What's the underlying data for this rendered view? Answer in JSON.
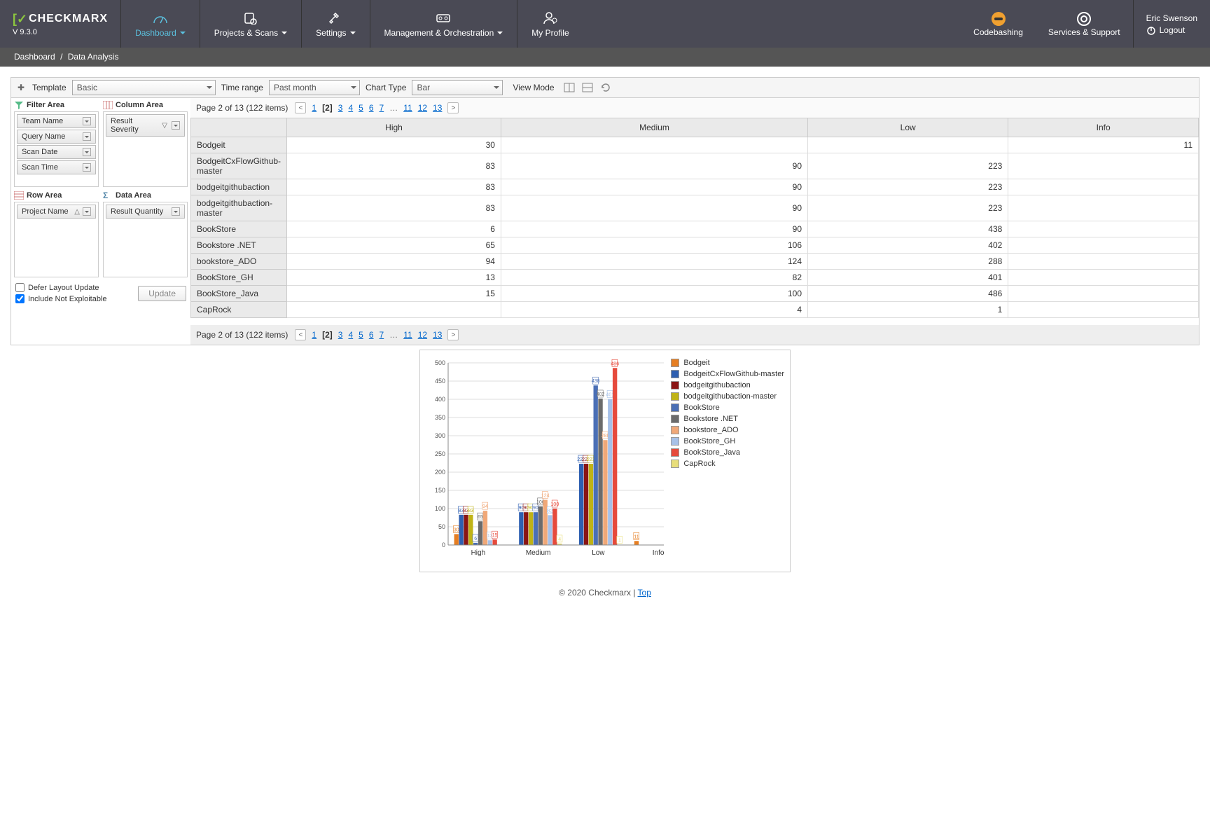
{
  "brand": {
    "prefix": "C",
    "name": "CHECKMARX",
    "version": "V 9.3.0"
  },
  "nav": [
    {
      "label": "Dashboard",
      "active": true,
      "dd": true
    },
    {
      "label": "Projects & Scans",
      "active": false,
      "dd": true
    },
    {
      "label": "Settings",
      "active": false,
      "dd": true
    },
    {
      "label": "Management & Orchestration",
      "active": false,
      "dd": true
    },
    {
      "label": "My Profile",
      "active": false,
      "dd": false
    }
  ],
  "header_right": {
    "codebashing": "Codebashing",
    "services": "Services & Support"
  },
  "user": {
    "name": "Eric Swenson",
    "logout": "Logout"
  },
  "breadcrumb": {
    "a": "Dashboard",
    "b": "Data Analysis"
  },
  "toolbar": {
    "template_label": "Template",
    "template_value": "Basic",
    "time_label": "Time range",
    "time_value": "Past month",
    "chart_label": "Chart Type",
    "chart_value": "Bar",
    "view_label": "View Mode"
  },
  "areas": {
    "filter": {
      "title": "Filter Area",
      "fields": [
        "Team Name",
        "Query Name",
        "Scan Date",
        "Scan Time"
      ]
    },
    "column": {
      "title": "Column Area",
      "fields": [
        "Result Severity"
      ]
    },
    "row": {
      "title": "Row Area",
      "fields": [
        "Project Name"
      ]
    },
    "data": {
      "title": "Data Area",
      "fields": [
        "Result Quantity"
      ]
    }
  },
  "options": {
    "defer": "Defer Layout Update",
    "include": "Include Not Exploitable",
    "update_btn": "Update"
  },
  "pager": {
    "info": "Page 2 of 13 (122 items)",
    "pages": [
      "1",
      "[2]",
      "3",
      "4",
      "5",
      "6",
      "7",
      "…",
      "11",
      "12",
      "13"
    ]
  },
  "table": {
    "columns": [
      "High",
      "Medium",
      "Low",
      "Info"
    ],
    "rows": [
      {
        "name": "Bodgeit",
        "v": [
          "30",
          "",
          "",
          "11"
        ]
      },
      {
        "name": "BodgeitCxFlowGithub-master",
        "v": [
          "83",
          "90",
          "223",
          ""
        ]
      },
      {
        "name": "bodgeitgithubaction",
        "v": [
          "83",
          "90",
          "223",
          ""
        ]
      },
      {
        "name": "bodgeitgithubaction-master",
        "v": [
          "83",
          "90",
          "223",
          ""
        ]
      },
      {
        "name": "BookStore",
        "v": [
          "6",
          "90",
          "438",
          ""
        ]
      },
      {
        "name": "Bookstore .NET",
        "v": [
          "65",
          "106",
          "402",
          ""
        ]
      },
      {
        "name": "bookstore_ADO",
        "v": [
          "94",
          "124",
          "288",
          ""
        ]
      },
      {
        "name": "BookStore_GH",
        "v": [
          "13",
          "82",
          "401",
          ""
        ]
      },
      {
        "name": "BookStore_Java",
        "v": [
          "15",
          "100",
          "486",
          ""
        ]
      },
      {
        "name": "CapRock",
        "v": [
          "",
          "4",
          "1",
          ""
        ]
      }
    ]
  },
  "chart_data": {
    "type": "bar",
    "categories": [
      "High",
      "Medium",
      "Low",
      "Info"
    ],
    "ylim": [
      0,
      500
    ],
    "yticks": [
      0,
      50,
      100,
      150,
      200,
      250,
      300,
      350,
      400,
      450,
      500
    ],
    "series": [
      {
        "name": "Bodgeit",
        "color": "#e67e22",
        "values": [
          30,
          null,
          null,
          11
        ]
      },
      {
        "name": "BodgeitCxFlowGithub-master",
        "color": "#2e5fb1",
        "values": [
          83,
          90,
          223,
          null
        ]
      },
      {
        "name": "bodgeitgithubaction",
        "color": "#8a1515",
        "values": [
          83,
          90,
          223,
          null
        ]
      },
      {
        "name": "bodgeitgithubaction-master",
        "color": "#c0b316",
        "values": [
          83,
          90,
          223,
          null
        ]
      },
      {
        "name": "BookStore",
        "color": "#4a6fb5",
        "values": [
          6,
          90,
          438,
          null
        ]
      },
      {
        "name": "Bookstore .NET",
        "color": "#6b6b6b",
        "values": [
          65,
          106,
          402,
          null
        ]
      },
      {
        "name": "bookstore_ADO",
        "color": "#f0a878",
        "values": [
          94,
          124,
          288,
          null
        ]
      },
      {
        "name": "BookStore_GH",
        "color": "#a7c1e8",
        "values": [
          13,
          82,
          401,
          null
        ]
      },
      {
        "name": "BookStore_Java",
        "color": "#e64a3c",
        "values": [
          15,
          100,
          486,
          null
        ]
      },
      {
        "name": "CapRock",
        "color": "#e8de7a",
        "values": [
          null,
          4,
          1,
          null
        ]
      }
    ]
  },
  "footer": {
    "copyright": "© 2020 Checkmarx | ",
    "top": "Top"
  }
}
